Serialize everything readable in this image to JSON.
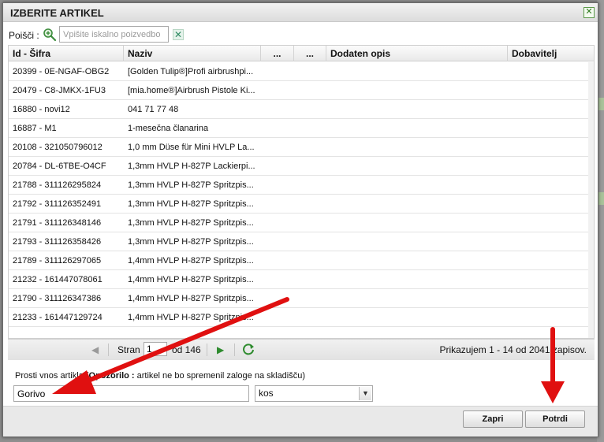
{
  "dialog": {
    "title": "IZBERITE ARTIKEL",
    "close_glyph": "✕"
  },
  "search": {
    "label": "Poišči :",
    "icon": "search-icon",
    "placeholder": "Vpišite iskalno poizvedbo",
    "value": "",
    "clear_glyph": "✕"
  },
  "grid": {
    "columns": [
      "Id - Šifra",
      "Naziv",
      "...",
      "...",
      "Dodaten opis",
      "Dobavitelj"
    ],
    "rows": [
      {
        "id": "20399 - 0E-NGAF-OBG2",
        "naziv": "[Golden Tulip®]Profi airbrushpi..."
      },
      {
        "id": "20479 - C8-JMKX-1FU3",
        "naziv": "[mia.home®]Airbrush Pistole Ki..."
      },
      {
        "id": "16880 - novi12",
        "naziv": "041 71 77 48"
      },
      {
        "id": "16887 - M1",
        "naziv": "1-mesečna članarina"
      },
      {
        "id": "20108 - 321050796012",
        "naziv": "1,0 mm Düse für Mini HVLP La..."
      },
      {
        "id": "20784 - DL-6TBE-O4CF",
        "naziv": "1,3mm HVLP H-827P Lackierpi..."
      },
      {
        "id": "21788 - 311126295824",
        "naziv": "1,3mm HVLP H-827P Spritzpis..."
      },
      {
        "id": "21792 - 311126352491",
        "naziv": "1,3mm HVLP H-827P Spritzpis..."
      },
      {
        "id": "21791 - 311126348146",
        "naziv": "1,3mm HVLP H-827P Spritzpis..."
      },
      {
        "id": "21793 - 311126358426",
        "naziv": "1,3mm HVLP H-827P Spritzpis..."
      },
      {
        "id": "21789 - 311126297065",
        "naziv": "1,4mm HVLP H-827P Spritzpis..."
      },
      {
        "id": "21232 - 161447078061",
        "naziv": "1,4mm HVLP H-827P Spritzpis..."
      },
      {
        "id": "21790 - 311126347386",
        "naziv": "1,4mm HVLP H-827P Spritzpis..."
      },
      {
        "id": "21233 - 161447129724",
        "naziv": "1,4mm HVLP H-827P Spritzpis..."
      }
    ]
  },
  "pager": {
    "first_glyph": "◀",
    "page_label": "Stran",
    "page_value": "1",
    "of_label": "od 146",
    "next_glyph": "▶",
    "refresh_icon": "refresh-icon",
    "info": "Prikazujem 1 - 14 od 2041 zapisov."
  },
  "manual": {
    "label_prefix": "Prosti vnos artikla (",
    "label_bold": "Opozorilo :",
    "label_suffix": " artikel ne bo spremenil zaloge na skladišču)",
    "name_value": "Gorivo",
    "unit_value": "kos",
    "unit_arrow_glyph": "▼"
  },
  "buttons": {
    "close": "Zapri",
    "confirm": "Potrdi"
  },
  "colors": {
    "annotation_arrow": "#e01010",
    "accent_green": "#2e8b2e"
  }
}
